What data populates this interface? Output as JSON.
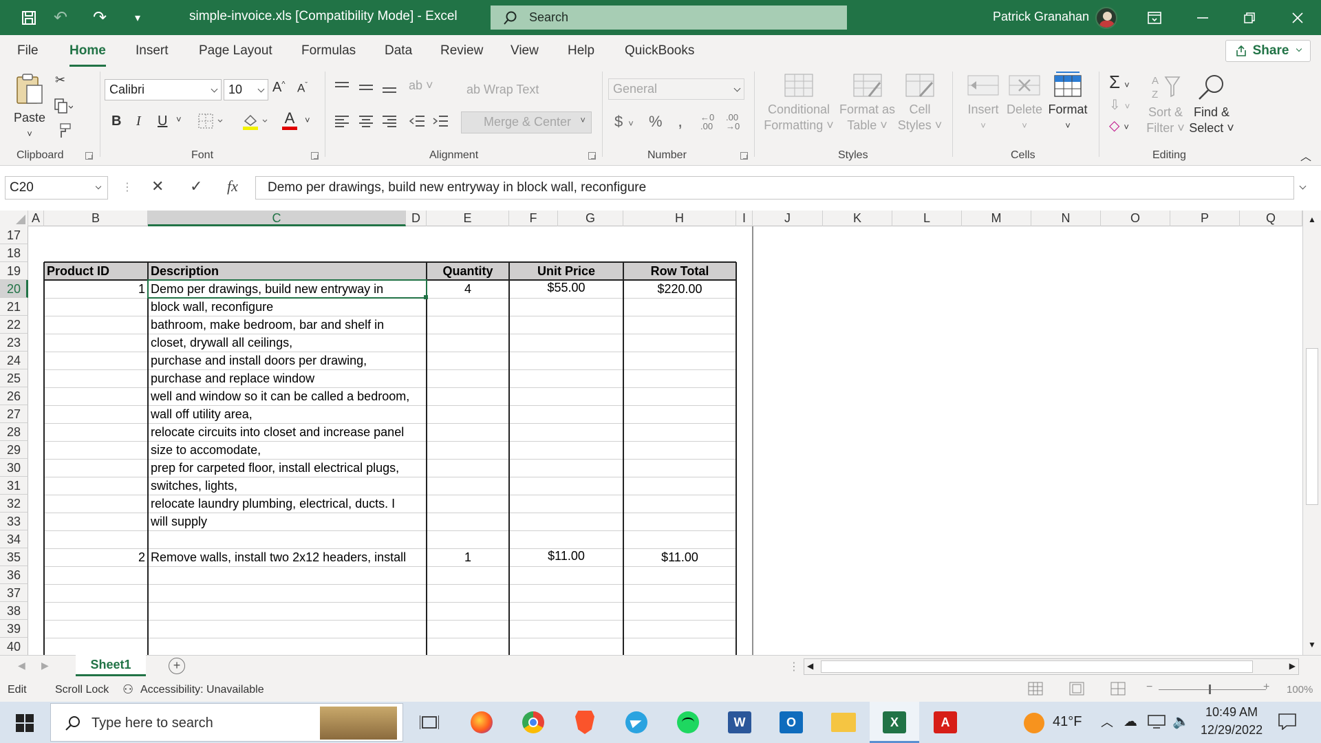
{
  "titlebar": {
    "doc_title": "simple-invoice.xls  [Compatibility Mode]  -  Excel",
    "search_placeholder": "Search",
    "user_name": "Patrick Granahan"
  },
  "menu": {
    "tabs": [
      "File",
      "Home",
      "Insert",
      "Page Layout",
      "Formulas",
      "Data",
      "Review",
      "View",
      "Help",
      "QuickBooks"
    ],
    "active": "Home",
    "share": "Share"
  },
  "ribbon": {
    "clipboard": {
      "label": "Clipboard",
      "paste": "Paste"
    },
    "font": {
      "label": "Font",
      "family": "Calibri",
      "size": "10",
      "bold": "B",
      "italic": "I",
      "underline": "U",
      "font_color_letter": "A"
    },
    "alignment": {
      "label": "Alignment",
      "wrap_text": "Wrap Text",
      "merge_center": "Merge & Center"
    },
    "number": {
      "label": "Number",
      "format": "General",
      "currency": "$",
      "percent": "%",
      "comma": ","
    },
    "styles": {
      "label": "Styles",
      "conditional_formatting": [
        "Conditional",
        "Formatting"
      ],
      "format_as_table": [
        "Format as",
        "Table"
      ],
      "cell_styles": [
        "Cell",
        "Styles"
      ]
    },
    "cells": {
      "label": "Cells",
      "insert": "Insert",
      "delete": "Delete",
      "format": "Format"
    },
    "editing": {
      "label": "Editing",
      "sort_filter": [
        "Sort &",
        "Filter"
      ],
      "find_select": [
        "Find &",
        "Select"
      ]
    }
  },
  "formula_bar": {
    "name_box": "C20",
    "fx": "fx",
    "content": "Demo per drawings, build new entryway in block wall, reconfigure"
  },
  "columns": [
    "A",
    "B",
    "C",
    "D",
    "E",
    "F",
    "G",
    "H",
    "I",
    "J",
    "K",
    "L",
    "M",
    "N",
    "O",
    "P",
    "Q"
  ],
  "rows": [
    "17",
    "18",
    "19",
    "20",
    "21",
    "22",
    "23",
    "24",
    "25",
    "26",
    "27",
    "28",
    "29",
    "30",
    "31",
    "32",
    "33",
    "34",
    "35",
    "36",
    "37",
    "38",
    "39",
    "40"
  ],
  "table": {
    "headers": [
      "Product ID",
      "Description",
      "Quantity",
      "Unit Price",
      "Row Total"
    ],
    "item1": {
      "id": "1",
      "quantity": "4",
      "unit_price": "$55.00",
      "row_total": "$220.00"
    },
    "item1_lines": [
      "Demo per drawings, build new entryway in",
      "block wall, reconfigure",
      "bathroom, make bedroom, bar and shelf in",
      "closet, drywall all ceilings,",
      "purchase and install doors per drawing,",
      "purchase and replace window",
      "well and window so it can be called a bedroom,",
      "wall off utility area,",
      "relocate circuits into closet and increase panel",
      "size to accomodate,",
      "prep for carpeted floor, install electrical plugs,",
      "switches, lights,",
      "relocate laundry plumbing, electrical, ducts. I",
      "will supply"
    ],
    "item2": {
      "id": "2",
      "description": "Remove walls, install two 2x12 headers, install",
      "quantity": "1",
      "unit_price": "$11.00",
      "row_total": "$11.00"
    }
  },
  "sheet_tabs": {
    "active": "Sheet1",
    "add": "+"
  },
  "status": {
    "mode": "Edit",
    "scroll_lock": "Scroll Lock",
    "accessibility": "Accessibility: Unavailable",
    "zoom": "100%"
  },
  "taskbar": {
    "search_placeholder": "Type here to search",
    "weather": "41°F",
    "time": "10:49 AM",
    "date": "12/29/2022"
  },
  "colors": {
    "excel_green": "#217346",
    "ribbon_bg": "#f3f2f1"
  }
}
